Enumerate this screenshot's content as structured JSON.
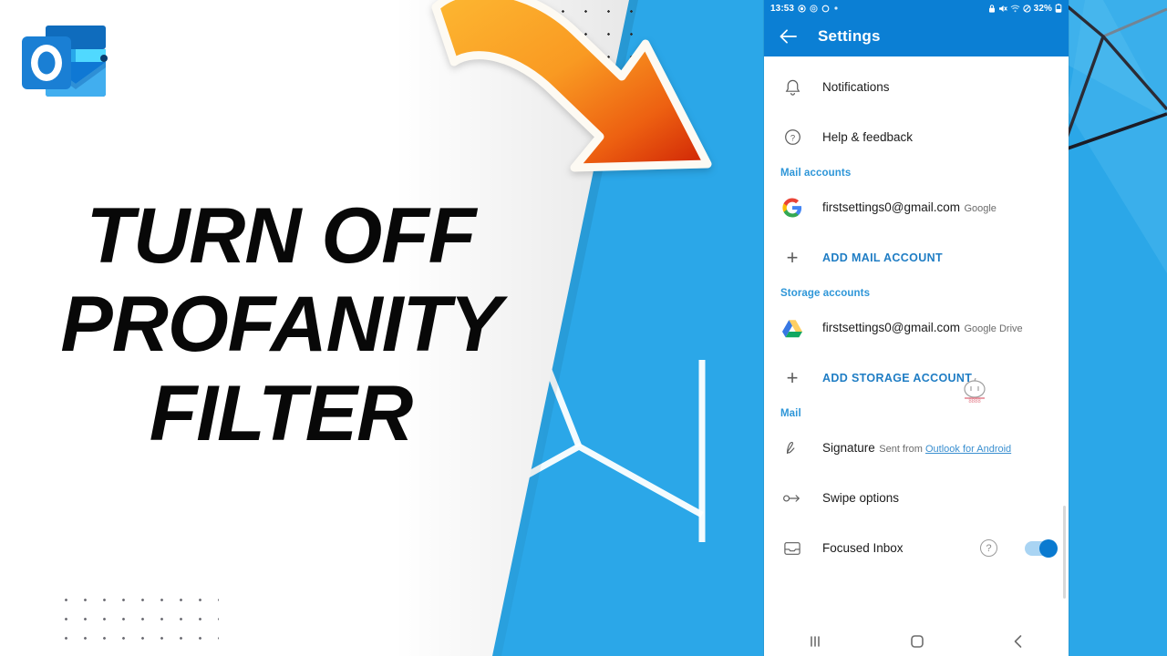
{
  "thumbnail": {
    "headline_line1": "TURN OFF",
    "headline_line2": "PROFANITY",
    "headline_line3": "FILTER",
    "logo_name": "outlook-logo",
    "arrow_name": "orange-curved-arrow",
    "colors": {
      "background_blue": "#2BA7E8",
      "panel_white": "#FFFFFF",
      "arrow_start": "#FBB03B",
      "arrow_end": "#D42A06",
      "headline_black": "#080808"
    }
  },
  "phone": {
    "statusbar": {
      "time": "13:53",
      "left_icons": [
        "record-icon",
        "screenshot-icon",
        "circle-icon",
        "dot-icon"
      ],
      "right_icons": [
        "lock-icon",
        "mute-icon",
        "wifi-icon",
        "do-not-disturb-icon"
      ],
      "battery_percent": "32%",
      "battery_icon": "battery-icon"
    },
    "appbar": {
      "back_icon": "arrow-left-icon",
      "title": "Settings",
      "color": "#0b7fd4"
    },
    "rows": [
      {
        "id": "notifications",
        "icon": "bell-icon",
        "title": "Notifications",
        "type": "item"
      },
      {
        "id": "help-feedback",
        "icon": "question-circle-icon",
        "title": "Help & feedback",
        "type": "item"
      }
    ],
    "sections": [
      {
        "id": "mail-accounts",
        "header": "Mail accounts",
        "rows": [
          {
            "id": "account-google",
            "icon": "google-g-icon",
            "title": "firstsettings0@gmail.com",
            "sub": "Google",
            "type": "account"
          },
          {
            "id": "add-mail-account",
            "icon": "plus-icon",
            "title": "ADD MAIL ACCOUNT",
            "type": "action"
          }
        ]
      },
      {
        "id": "storage-accounts",
        "header": "Storage accounts",
        "rows": [
          {
            "id": "account-google-drive",
            "icon": "google-drive-icon",
            "title": "firstsettings0@gmail.com",
            "sub": "Google Drive",
            "type": "account"
          },
          {
            "id": "add-storage-account",
            "icon": "plus-icon",
            "title": "ADD STORAGE ACCOUNT",
            "type": "action"
          }
        ]
      },
      {
        "id": "mail",
        "header": "Mail",
        "rows": [
          {
            "id": "signature",
            "icon": "signature-pen-icon",
            "title": "Signature",
            "sub_prefix": "Sent from ",
            "sub_link": "Outlook for Android",
            "type": "signature"
          },
          {
            "id": "swipe-options",
            "icon": "swipe-arrow-icon",
            "title": "Swipe options",
            "type": "item"
          },
          {
            "id": "focused-inbox",
            "icon": "inbox-icon",
            "title": "Focused Inbox",
            "help_icon": "question-circle-icon",
            "toggle": "on",
            "type": "toggle"
          }
        ]
      }
    ],
    "navbar": {
      "recents_icon": "recents-icon",
      "home_icon": "home-icon",
      "back_icon": "back-chevron-icon"
    }
  }
}
